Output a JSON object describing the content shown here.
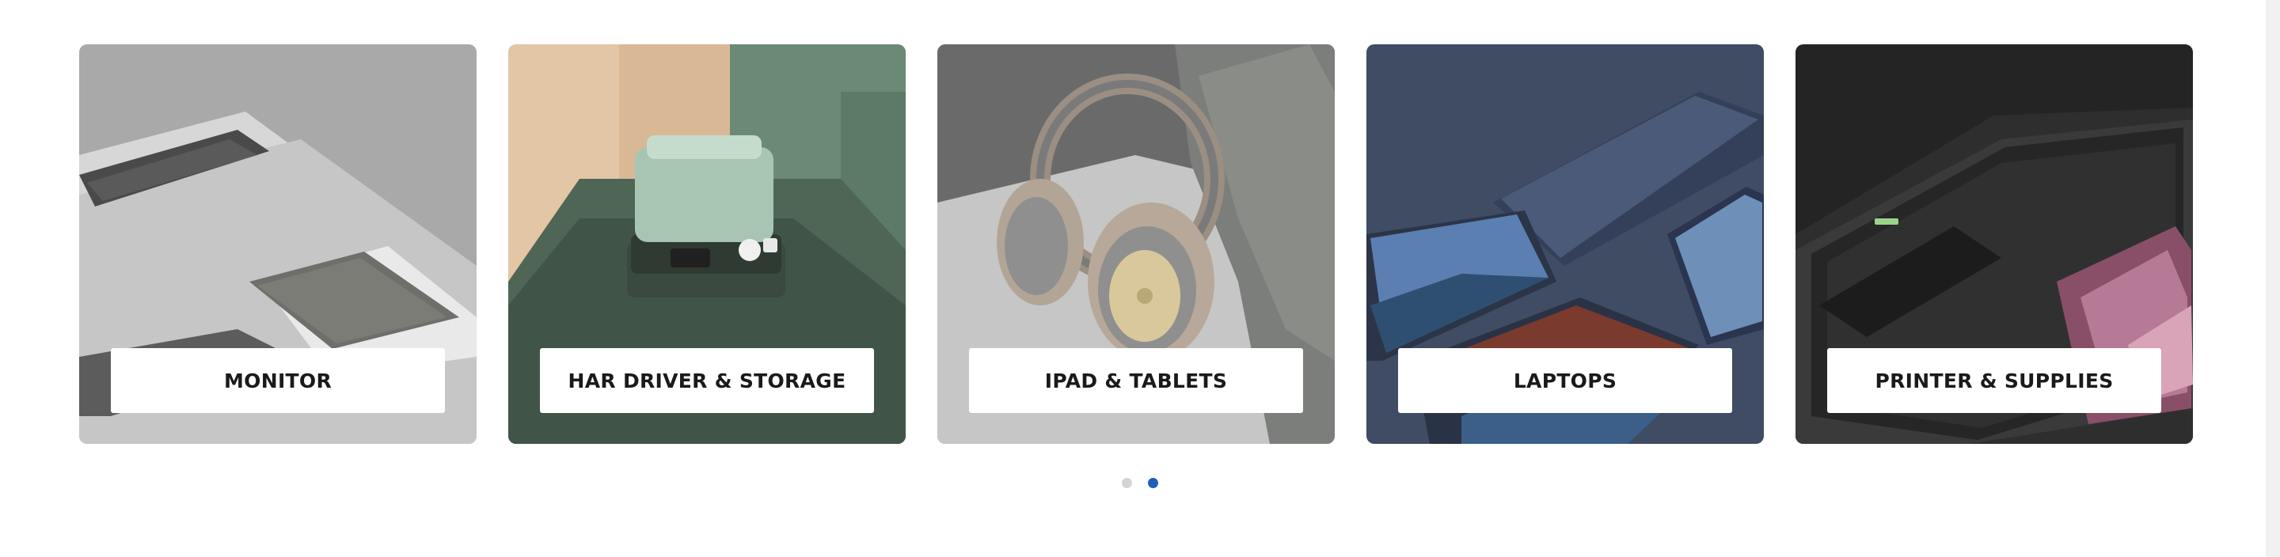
{
  "categories": [
    {
      "label": "MONITOR",
      "theme": "#a9a9a9"
    },
    {
      "label": "HAR DRIVER & STORAGE",
      "theme": "#58705f"
    },
    {
      "label": "IPAD & TABLETS",
      "theme": "#8c8c8c"
    },
    {
      "label": "LAPTOPS",
      "theme": "#3d4a60"
    },
    {
      "label": "PRINTER & SUPPLIES",
      "theme": "#252525"
    }
  ],
  "pagination": {
    "count": 2,
    "active_index": 1,
    "active_color": "#1f5fb8",
    "inactive_color": "#d4d4d4"
  }
}
